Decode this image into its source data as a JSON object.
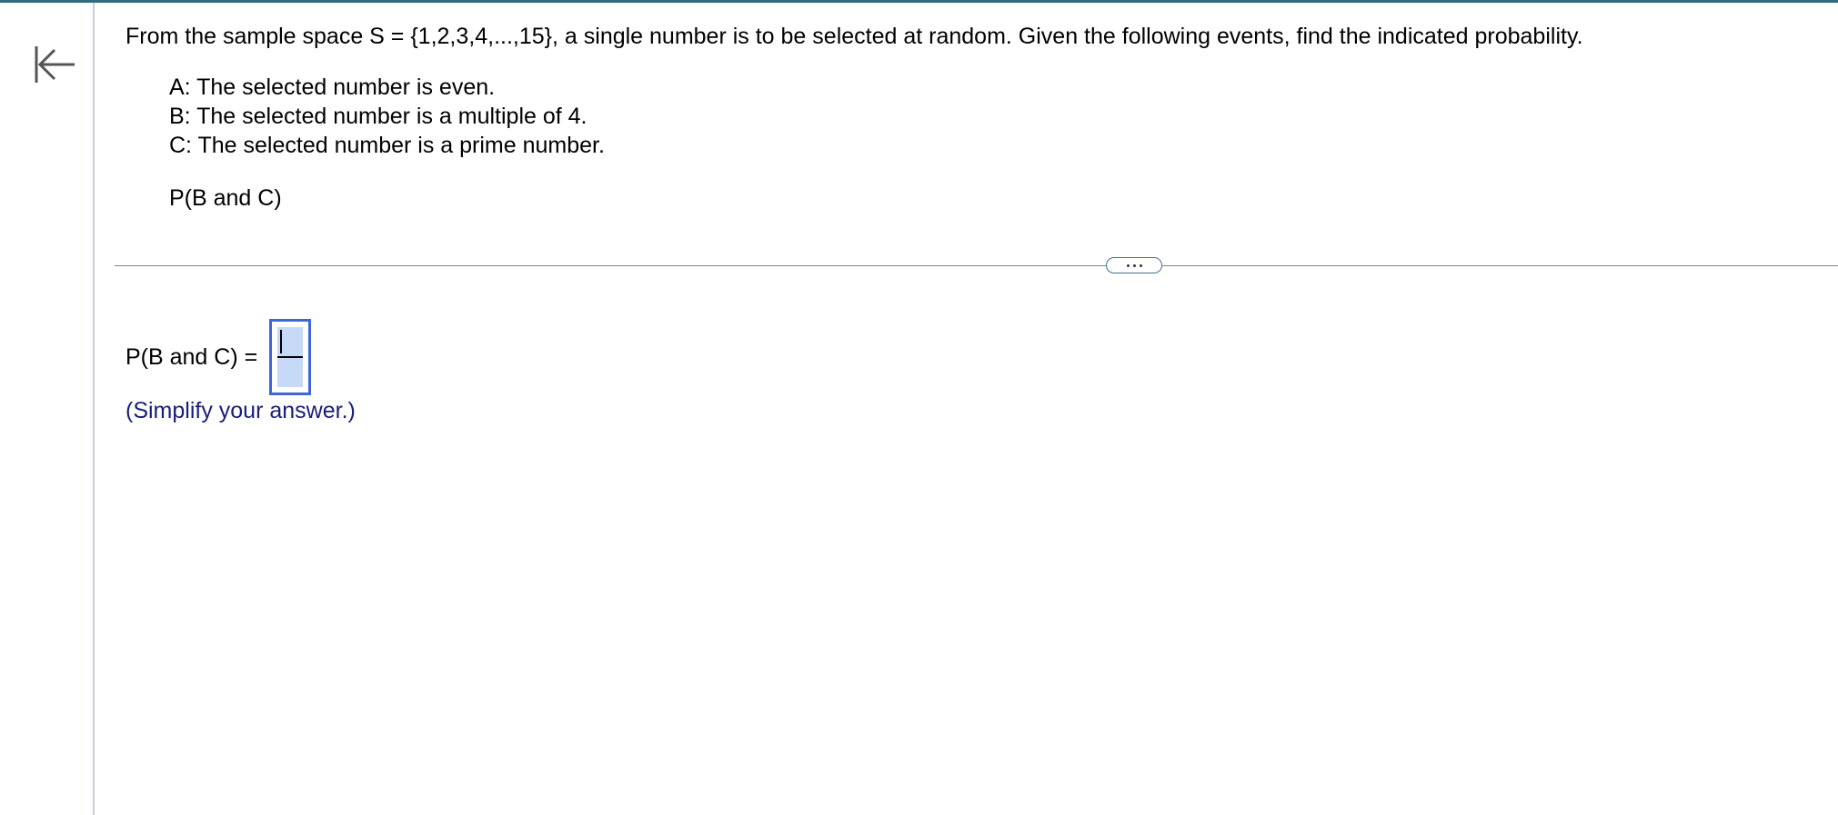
{
  "question": {
    "text": "From the sample space S = {1,2,3,4,...,15}, a single number is to be selected at random. Given the following events, find the indicated probability."
  },
  "events": [
    "A: The selected number is even.",
    "B: The selected number is a multiple of 4.",
    "C: The selected number is a prime number."
  ],
  "prompt": "P(B and C)",
  "answer": {
    "label": "P(B and C) = ",
    "numerator": "",
    "denominator": ""
  },
  "hint": "(Simplify your answer.)",
  "icons": {
    "collapse": "collapse-left-icon",
    "more": "more-options-icon"
  },
  "colors": {
    "accent_bar": "#2f6b7f",
    "input_border": "#3d66d6",
    "input_fill": "#c6d9f7",
    "hint_text": "#1a1d7a"
  }
}
